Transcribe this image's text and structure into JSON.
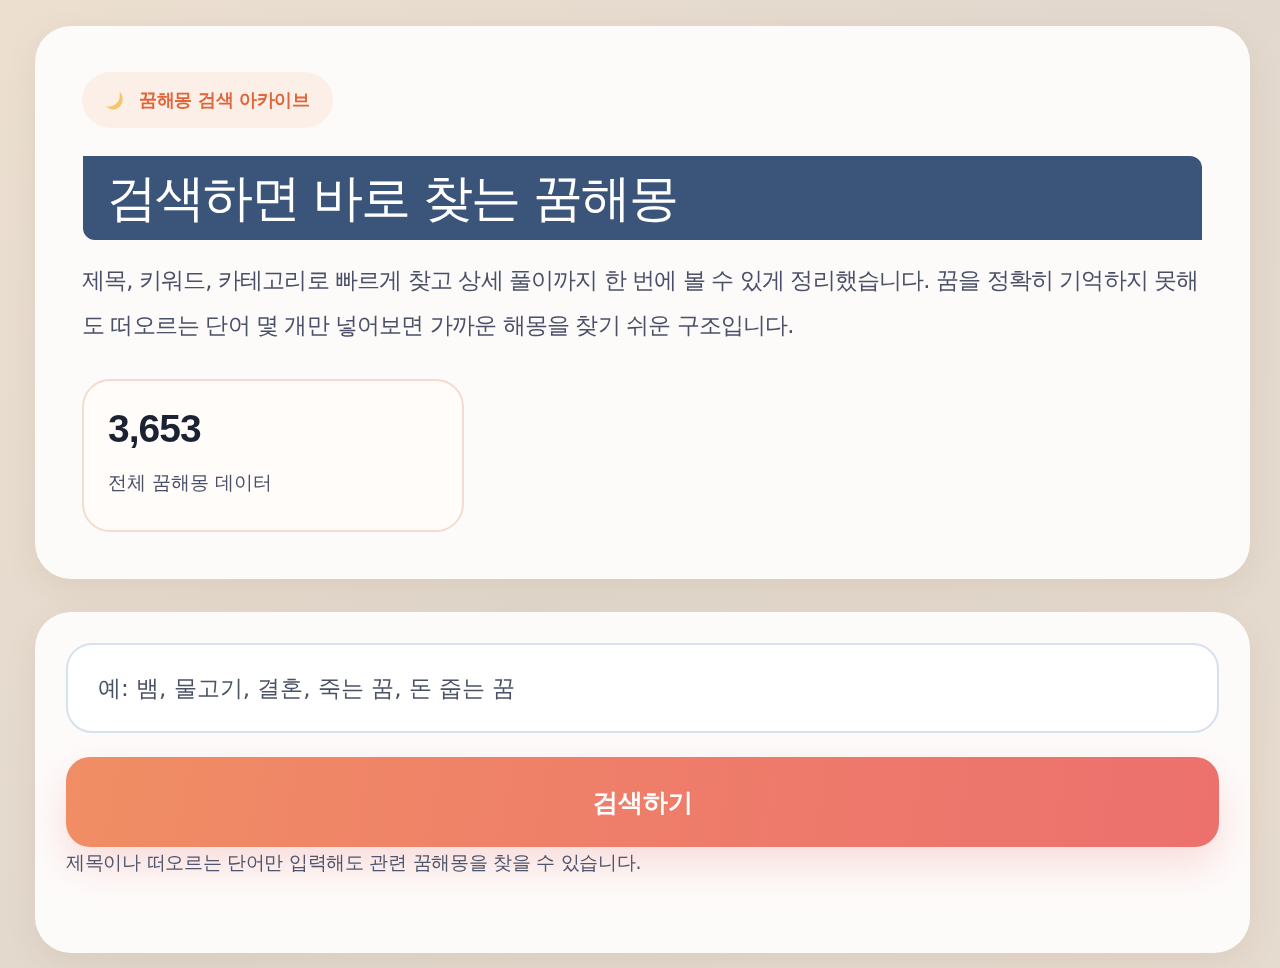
{
  "badge": {
    "label": "꿈해몽 검색 아카이브"
  },
  "hero": {
    "title": "검색하면 바로 찾는 꿈해몽",
    "description": "제목, 키워드, 카테고리로 빠르게 찾고 상세 풀이까지 한 번에 볼 수 있게 정리했습니다. 꿈을 정확히 기억하지 못해도 떠오르는 단어 몇 개만 넣어보면 가까운 해몽을 찾기 쉬운 구조입니다."
  },
  "stats": [
    {
      "value": "3,653",
      "label": "전체 꿈해몽 데이터"
    }
  ],
  "search": {
    "placeholder": "예: 뱀, 물고기, 결혼, 죽는 꿈, 돈 줍는 꿈",
    "button": "검색하기",
    "hint": "제목이나 떠오르는 단어만 입력해도 관련 꿈해몽을 찾을 수 있습니다."
  }
}
